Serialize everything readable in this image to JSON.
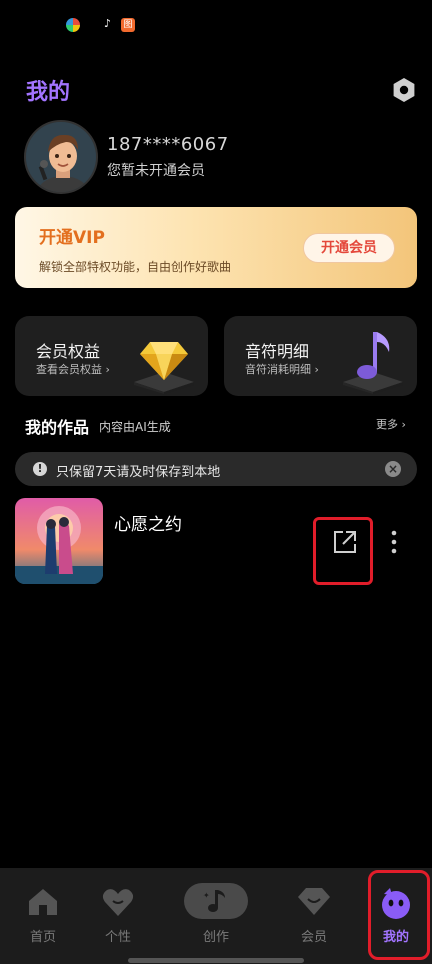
{
  "status_bar": {
    "app_badge": "图"
  },
  "header": {
    "title": "我的"
  },
  "profile": {
    "phone": "187****6067",
    "member_status": "您暂未开通会员"
  },
  "vip_banner": {
    "title": "开通VIP",
    "description": "解锁全部特权功能，自由创作好歌曲",
    "button_label": "开通会员"
  },
  "cards": {
    "benefits": {
      "title": "会员权益",
      "subtitle": "查看会员权益 ›"
    },
    "notes": {
      "title": "音符明细",
      "subtitle": "音符消耗明细 ›"
    }
  },
  "works": {
    "title": "我的作品",
    "subtitle": "内容由AI生成",
    "more_label": "更多 ›",
    "notice": "只保留7天请及时保存到本地",
    "items": [
      {
        "title": "心愿之约"
      }
    ]
  },
  "bottom_nav": {
    "items": [
      {
        "label": "首页",
        "icon": "home-icon"
      },
      {
        "label": "个性",
        "icon": "heart-face-icon"
      },
      {
        "label": "创作",
        "icon": "music-note-icon"
      },
      {
        "label": "会员",
        "icon": "diamond-icon"
      },
      {
        "label": "我的",
        "icon": "mascot-icon"
      }
    ],
    "active_index": 4
  },
  "colors": {
    "accent": "#a274ff",
    "vip_title": "#e36f1e",
    "vip_button_text": "#e4483b",
    "highlight": "#e11d2a"
  }
}
